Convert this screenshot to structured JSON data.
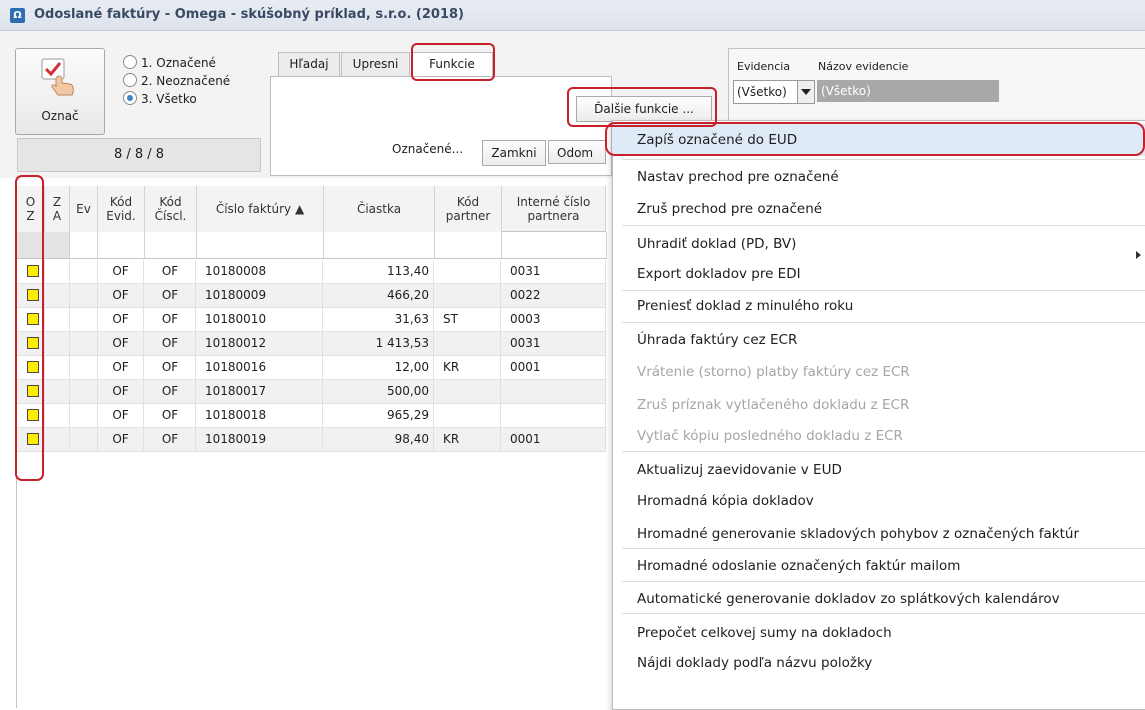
{
  "window": {
    "title": "Odoslané faktúry - Omega - skúšobný príklad, s.r.o. (2018)",
    "icon": "omega-icon"
  },
  "mark": {
    "button_label": "Označ",
    "options": [
      "1. Označené",
      "2. Neoznačené",
      "3. Všetko"
    ],
    "selected": "3. Všetko",
    "counter": "8 / 8 / 8"
  },
  "tabs": [
    {
      "label": "Hľadaj"
    },
    {
      "label": "Upresni"
    },
    {
      "label": "Funkcie"
    }
  ],
  "active_tab": "Funkcie",
  "functions": {
    "more_button": "Ďalšie funkcie ...",
    "marked_label": "Označené...",
    "lock_button": "Zamkni",
    "unlock_button": "Odom"
  },
  "evidence": {
    "label": "Evidencia",
    "name_label": "Názov evidencie",
    "select_value": "(Všetko)",
    "name_value": "(Všetko)"
  },
  "grid": {
    "headers": [
      "O Z",
      "Z A",
      "Ev",
      "Kód Evid.",
      "Kód Číscl.",
      "Číslo faktúry ▲",
      "Čiastka",
      "Kód partner",
      "Interné číslo partnera"
    ],
    "rows": [
      {
        "ev": "OF",
        "cis": "OF",
        "num": "10180008",
        "amount": "113,40",
        "partner": "",
        "internal": "0031"
      },
      {
        "ev": "OF",
        "cis": "OF",
        "num": "10180009",
        "amount": "466,20",
        "partner": "",
        "internal": "0022"
      },
      {
        "ev": "OF",
        "cis": "OF",
        "num": "10180010",
        "amount": "31,63",
        "partner": "ST",
        "internal": "0003"
      },
      {
        "ev": "OF",
        "cis": "OF",
        "num": "10180012",
        "amount": "1 413,53",
        "partner": "",
        "internal": "0031"
      },
      {
        "ev": "OF",
        "cis": "OF",
        "num": "10180016",
        "amount": "12,00",
        "partner": "KR",
        "internal": "0001"
      },
      {
        "ev": "OF",
        "cis": "OF",
        "num": "10180017",
        "amount": "500,00",
        "partner": "",
        "internal": ""
      },
      {
        "ev": "OF",
        "cis": "OF",
        "num": "10180018",
        "amount": "965,29",
        "partner": "",
        "internal": ""
      },
      {
        "ev": "OF",
        "cis": "OF",
        "num": "10180019",
        "amount": "98,40",
        "partner": "KR",
        "internal": "0001"
      }
    ]
  },
  "menu": {
    "items": [
      {
        "label": "Zapíš označené do EUD",
        "disabled": false
      },
      {
        "label": "Nastav prechod pre označené",
        "disabled": false
      },
      {
        "label": "Zruš prechod pre označené",
        "disabled": false
      },
      {
        "label": "Uhradiť doklad (PD, BV)",
        "disabled": false
      },
      {
        "label": "Export dokladov pre EDI",
        "disabled": false
      },
      {
        "label": "Preniesť doklad z minulého roku",
        "disabled": false
      },
      {
        "label": "Úhrada faktúry cez ECR",
        "disabled": false
      },
      {
        "label": "Vrátenie (storno) platby faktúry cez ECR",
        "disabled": true
      },
      {
        "label": "Zruš príznak vytlačeného dokladu z ECR",
        "disabled": true
      },
      {
        "label": "Vytlač kópiu posledného dokladu z ECR",
        "disabled": true
      },
      {
        "label": "Aktualizuj zaevidovanie v EUD",
        "disabled": false
      },
      {
        "label": "Hromadná kópia dokladov",
        "disabled": false
      },
      {
        "label": "Hromadné generovanie skladových pohybov z označených faktúr",
        "disabled": false
      },
      {
        "label": "Hromadné odoslanie označených faktúr mailom",
        "disabled": false
      },
      {
        "label": "Automatické generovanie dokladov zo splátkových kalendárov",
        "disabled": false
      },
      {
        "label": "Prepočet celkovej sumy na dokladoch",
        "disabled": false
      },
      {
        "label": "Nájdi doklady podľa názvu položky",
        "disabled": false
      }
    ]
  },
  "colors": {
    "annotation_red": "#c8202a",
    "mark_yellow": "#ffeb00",
    "highlight": "#dfeaf7"
  }
}
